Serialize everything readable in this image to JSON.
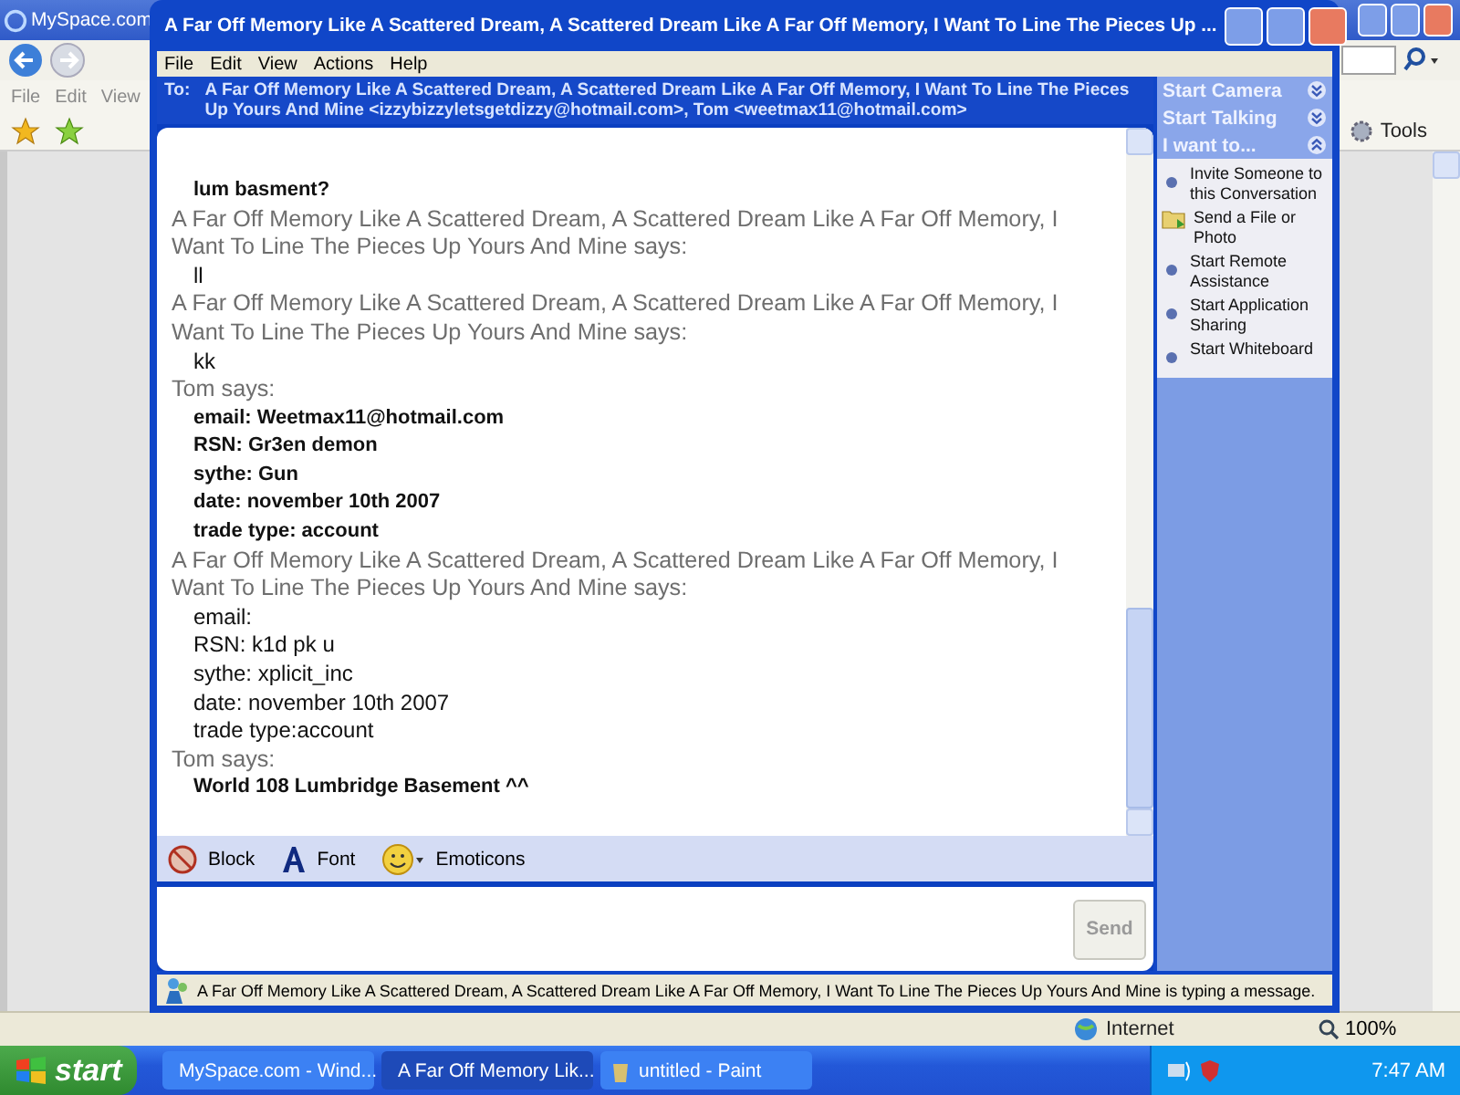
{
  "browser_window": {
    "title": "MySpace.com",
    "menu": [
      "File",
      "Edit",
      "View"
    ],
    "tools_button": "Tools",
    "status_bar": {
      "zone": "Internet",
      "zoom": "100%"
    }
  },
  "chat_window": {
    "title": "A Far Off Memory Like A Scattered Dream, A Scattered Dream Like A Far Off Memory, I Want To Line The Pieces Up ...",
    "menu": [
      "File",
      "Edit",
      "View",
      "Actions",
      "Help"
    ],
    "to_label": "To:",
    "recipients": "A Far Off Memory Like A Scattered Dream, A Scattered Dream Like A Far Off Memory, I Want To Line The Pieces Up Yours And Mine <izzybizzyletsgetdizzy@hotmail.com>, Tom <weetmax11@hotmail.com>",
    "messages": [
      {
        "kind": "bold",
        "lines": [
          "lum basment?"
        ]
      },
      {
        "kind": "plain",
        "sender": "A Far Off Memory Like A Scattered Dream, A Scattered Dream Like A Far Off Memory, I Want To Line The Pieces Up Yours And Mine says:",
        "lines": [
          "ll"
        ]
      },
      {
        "kind": "plain",
        "sender": "A Far Off Memory Like A Scattered Dream, A Scattered Dream Like A Far Off Memory, I Want To Line The Pieces Up Yours And Mine says:",
        "lines": [
          "kk"
        ]
      },
      {
        "kind": "bold",
        "sender": "Tom says:",
        "lines": [
          "email: Weetmax11@hotmail.com",
          "RSN: Gr3en demon",
          "sythe: Gun",
          "date: november 10th 2007",
          "trade type: account"
        ]
      },
      {
        "kind": "plain",
        "sender": "A Far Off Memory Like A Scattered Dream, A Scattered Dream Like A Far Off Memory, I Want To Line The Pieces Up Yours And Mine says:",
        "lines": [
          "email:",
          "RSN: k1d  pk  u",
          "sythe: xplicit_inc",
          "date: november 10th 2007",
          "trade type:account"
        ]
      },
      {
        "kind": "bold",
        "sender": "Tom says:",
        "lines": [
          "World 108 Lumbridge Basement ^^"
        ]
      }
    ],
    "toolbar": [
      {
        "kind": "block",
        "label": "Block"
      },
      {
        "kind": "font",
        "label": "Font"
      },
      {
        "kind": "emoticons",
        "label": "Emoticons"
      }
    ],
    "send_button": {
      "label": "Send",
      "disabled": true
    },
    "side_panel": [
      {
        "label": "Start Camera",
        "expanded": false
      },
      {
        "label": "Start Talking",
        "expanded": false
      },
      {
        "label": "I want to...",
        "expanded": true,
        "items": [
          {
            "kind": "bullet",
            "label": "Invite Someone to this Conversation"
          },
          {
            "kind": "file",
            "label": "Send a File or Photo"
          },
          {
            "kind": "bullet",
            "label": "Start Remote Assistance"
          },
          {
            "kind": "bullet",
            "label": "Start Application Sharing"
          },
          {
            "kind": "bullet",
            "label": "Start Whiteboard"
          }
        ]
      }
    ],
    "status": "A Far Off Memory Like A Scattered Dream, A Scattered Dream Like A Far Off Memory, I Want To Line The Pieces Up Yours And Mine is typing a message."
  },
  "taskbar": {
    "start_label": "start",
    "tasks": [
      {
        "kind": "browser",
        "label": "MySpace.com - Wind...",
        "selected": false
      },
      {
        "kind": "messenger",
        "label": "A Far Off Memory Lik...",
        "selected": true
      },
      {
        "kind": "paint",
        "label": "untitled - Paint",
        "selected": false
      }
    ],
    "clock": "7:47 AM"
  }
}
